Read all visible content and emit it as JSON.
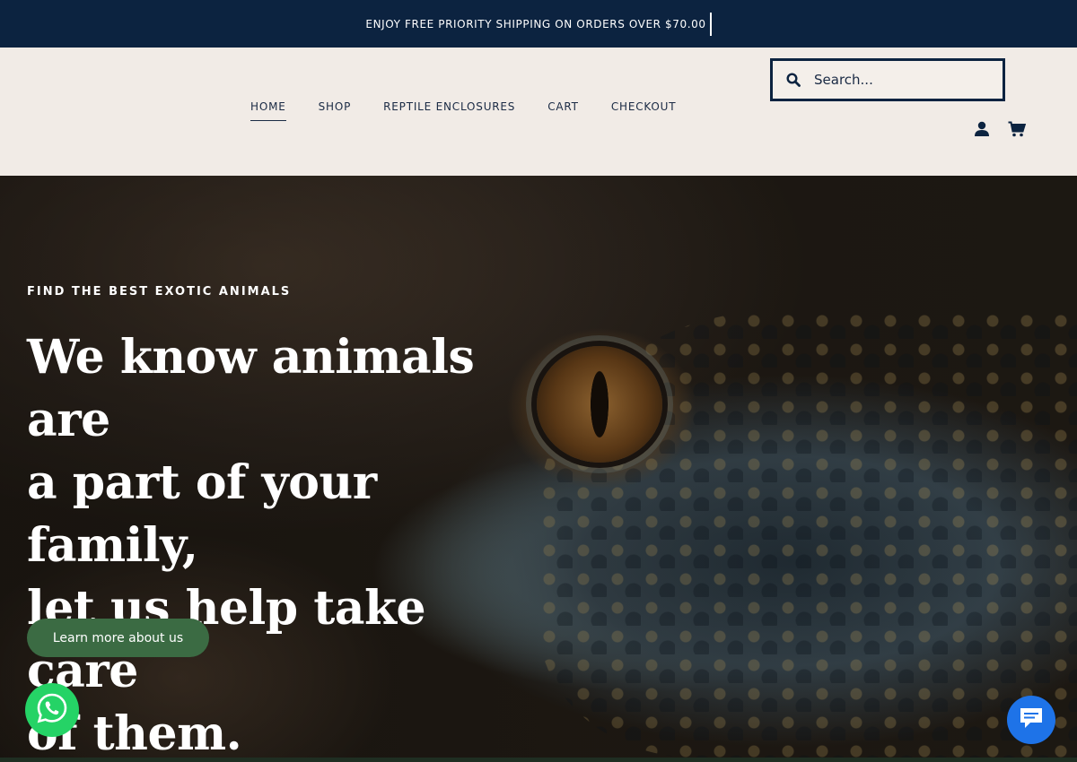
{
  "topbar": {
    "message": "ENJOY FREE PRIORITY SHIPPING ON ORDERS OVER $70.00"
  },
  "nav": {
    "items": [
      {
        "label": "HOME",
        "active": true
      },
      {
        "label": "SHOP",
        "active": false
      },
      {
        "label": "REPTILE ENCLOSURES",
        "active": false
      },
      {
        "label": "CART",
        "active": false
      },
      {
        "label": "CHECKOUT",
        "active": false
      }
    ]
  },
  "search": {
    "placeholder": "Search...",
    "icon": "search-icon"
  },
  "header_icons": {
    "account": "user-icon",
    "cart": "shopping-cart-icon"
  },
  "hero": {
    "eyebrow": "FIND THE BEST EXOTIC ANIMALS",
    "headline_lines": [
      "We know animals are",
      "a part of your family,",
      "let us help take care",
      "of them."
    ],
    "cta_label": "Learn more about us"
  },
  "floating": {
    "whatsapp": "whatsapp-icon",
    "chat": "chat-bubble-icon"
  },
  "colors": {
    "topbar_bg": "#0c2340",
    "header_bg": "#f1ebe6",
    "nav_text": "#1a2a44",
    "cta_bg": "#3b6b43",
    "whatsapp_bg": "#25d366",
    "chat_bg": "#1e73e8"
  }
}
